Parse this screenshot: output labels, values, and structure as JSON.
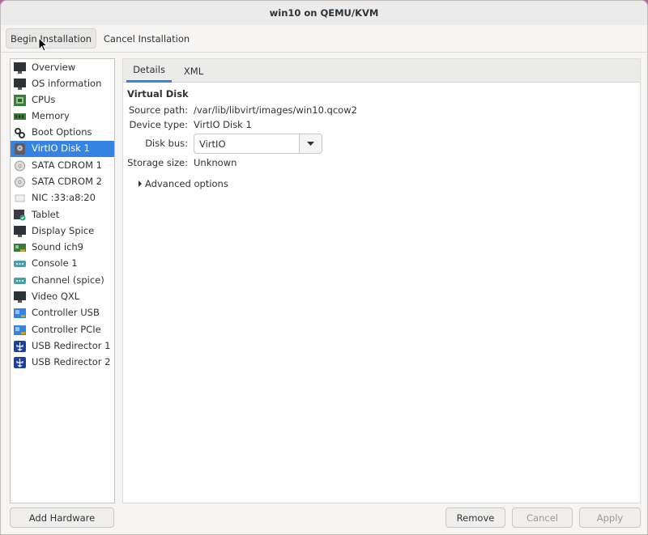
{
  "window": {
    "title": "win10 on QEMU/KVM"
  },
  "toolbar": {
    "begin_label": "Begin Installation",
    "cancel_label": "Cancel Installation"
  },
  "sidebar": {
    "items": [
      {
        "label": "Overview",
        "icon": "monitor-icon"
      },
      {
        "label": "OS information",
        "icon": "monitor-icon"
      },
      {
        "label": "CPUs",
        "icon": "cpu-icon"
      },
      {
        "label": "Memory",
        "icon": "memory-icon"
      },
      {
        "label": "Boot Options",
        "icon": "gears-icon"
      },
      {
        "label": "VirtIO Disk 1",
        "icon": "harddisk-icon",
        "selected": true
      },
      {
        "label": "SATA CDROM 1",
        "icon": "cdrom-icon"
      },
      {
        "label": "SATA CDROM 2",
        "icon": "cdrom-icon"
      },
      {
        "label": "NIC :33:a8:20",
        "icon": "network-icon"
      },
      {
        "label": "Tablet",
        "icon": "tablet-icon"
      },
      {
        "label": "Display Spice",
        "icon": "display-icon"
      },
      {
        "label": "Sound ich9",
        "icon": "sound-card-icon"
      },
      {
        "label": "Console 1",
        "icon": "serial-port-icon"
      },
      {
        "label": "Channel (spice)",
        "icon": "serial-port-icon"
      },
      {
        "label": "Video QXL",
        "icon": "video-card-icon"
      },
      {
        "label": "Controller USB",
        "icon": "controller-icon"
      },
      {
        "label": "Controller PCIe",
        "icon": "controller-icon"
      },
      {
        "label": "USB Redirector 1",
        "icon": "usb-icon"
      },
      {
        "label": "USB Redirector 2",
        "icon": "usb-icon"
      }
    ]
  },
  "tabs": {
    "details": "Details",
    "xml": "XML"
  },
  "details": {
    "section_title": "Virtual Disk",
    "source_path_label": "Source path:",
    "source_path_value": "/var/lib/libvirt/images/win10.qcow2",
    "device_type_label": "Device type:",
    "device_type_value": "VirtIO Disk 1",
    "disk_bus_label": "Disk bus:",
    "disk_bus_value": "VirtIO",
    "storage_size_label": "Storage size:",
    "storage_size_value": "Unknown",
    "advanced_label": "Advanced options"
  },
  "footer": {
    "add_hardware": "Add Hardware",
    "remove": "Remove",
    "cancel": "Cancel",
    "apply": "Apply"
  },
  "colors": {
    "accent": "#3584e4",
    "selected_text": "#ffffff"
  }
}
